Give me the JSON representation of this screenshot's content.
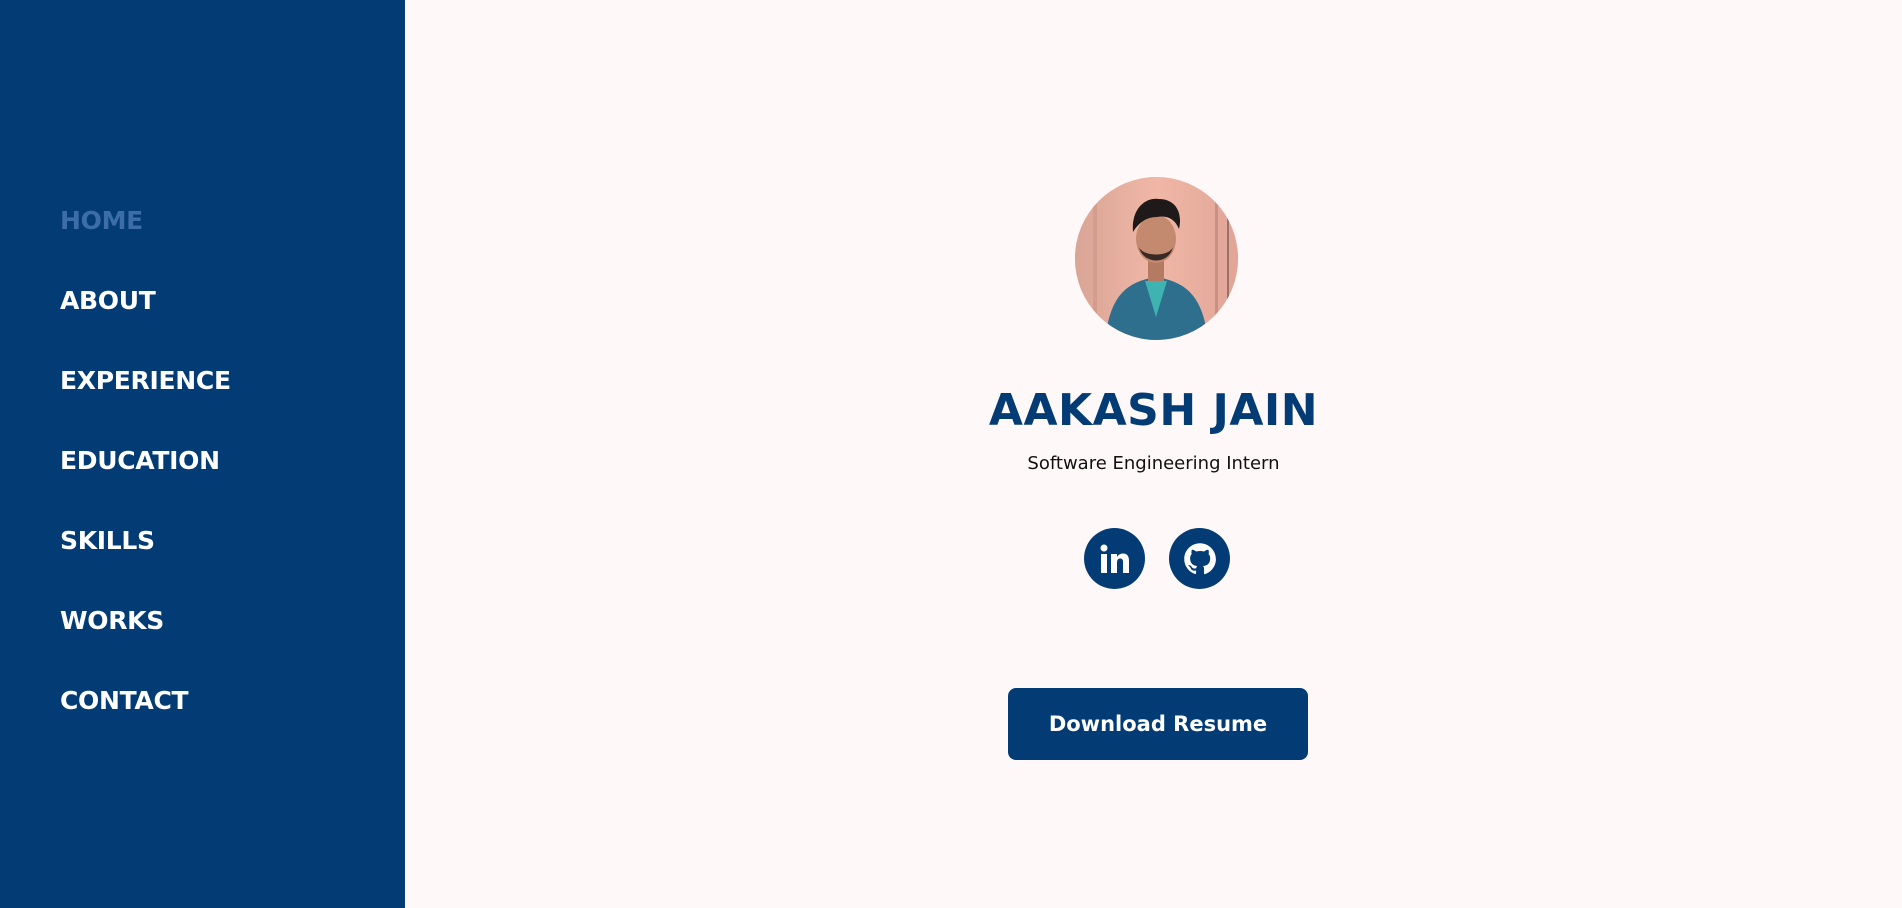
{
  "sidebar": {
    "items": [
      {
        "label": "HOME"
      },
      {
        "label": "ABOUT"
      },
      {
        "label": "EXPERIENCE"
      },
      {
        "label": "EDUCATION"
      },
      {
        "label": "SKILLS"
      },
      {
        "label": "WORKS"
      },
      {
        "label": "CONTACT"
      }
    ],
    "active": "HOME"
  },
  "profile": {
    "name": "AAKASH JAIN",
    "role": "Software Engineering Intern",
    "avatar_alt": "profile photo"
  },
  "socials": [
    {
      "icon": "linkedin-icon"
    },
    {
      "icon": "github-icon"
    }
  ],
  "actions": {
    "download_resume": "Download Resume"
  },
  "colors": {
    "primary": "#033c75",
    "active_nav": "#3d6da8",
    "background": "#fff8f8"
  }
}
